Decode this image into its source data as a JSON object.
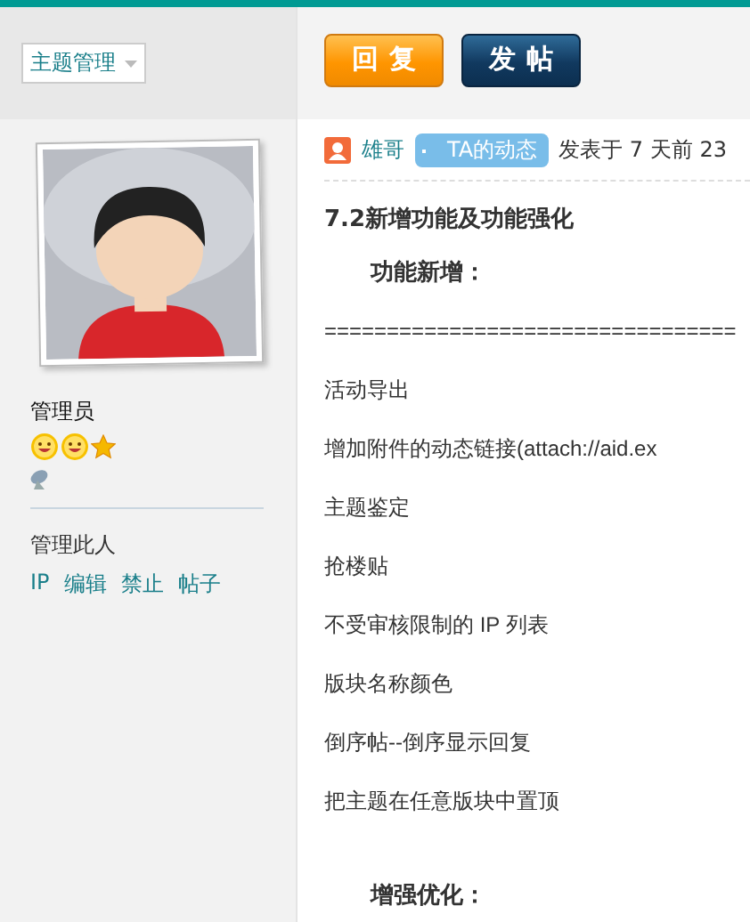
{
  "toolbar": {
    "dropdown": "主题管理",
    "buttons": [
      {
        "label": "回复",
        "kind": "reply"
      },
      {
        "label": "发帖",
        "kind": "post"
      }
    ]
  },
  "author": {
    "role": "管理员",
    "manage_label": "管理此人",
    "actions": [
      "IP",
      "编辑",
      "禁止",
      "帖子"
    ]
  },
  "post": {
    "author": "雄哥",
    "badge": "TA的动态",
    "posted": "发表于 7 天前 23",
    "title": "7.2新增功能及功能强化",
    "lines": [
      {
        "kind": "heading",
        "text": "功能新增："
      },
      {
        "kind": "text",
        "text": "================================="
      },
      {
        "kind": "text",
        "text": "活动导出"
      },
      {
        "kind": "text",
        "text": "增加附件的动态链接(attach://aid.ex"
      },
      {
        "kind": "text",
        "text": "主题鉴定"
      },
      {
        "kind": "text",
        "text": "抢楼贴"
      },
      {
        "kind": "text",
        "text": "不受审核限制的 IP 列表"
      },
      {
        "kind": "text",
        "text": "版块名称颜色"
      },
      {
        "kind": "text",
        "text": "倒序帖--倒序显示回复"
      },
      {
        "kind": "text",
        "text": "把主题在任意版块中置顶"
      },
      {
        "kind": "gap"
      },
      {
        "kind": "heading",
        "text": "增强优化："
      }
    ]
  }
}
